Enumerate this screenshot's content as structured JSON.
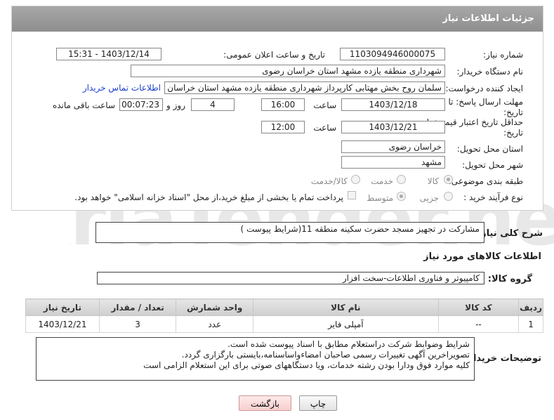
{
  "header": {
    "title": "جزئیات اطلاعات نیاز"
  },
  "fields": {
    "need_number_label": "شماره نیاز:",
    "need_number": "1103094946000075",
    "announce_label": "تاریخ و ساعت اعلان عمومی:",
    "announce_value": "1403/12/14 - 15:31",
    "buyer_label": "نام دستگاه خریدار:",
    "buyer_value": "شهرداری منطقه یازده مشهد استان خراسان رضوی",
    "requester_label": "ایجاد کننده درخواست:",
    "requester_value": "سلمان روح بخش مهتابی کارپرداز شهرداری منطقه یازده مشهد استان خراسان رضوی",
    "contact_link": "اطلاعات تماس خریدار",
    "reply_deadline_label": "مهلت ارسال پاسخ: تا",
    "reply_deadline_label2": "تاریخ:",
    "reply_date": "1403/12/18",
    "time_label": "ساعت",
    "reply_time": "16:00",
    "days_value": "4",
    "days_label": "روز و",
    "remaining_time": "00:07:23",
    "remaining_label": "ساعت باقی مانده",
    "price_deadline_label": "حداقل تاریخ اعتبار قیمت: تا",
    "price_deadline_label2": "تاریخ:",
    "price_date": "1403/12/21",
    "price_time": "12:00",
    "province_label": "استان محل تحویل:",
    "province_value": "خراسان رضوی",
    "city_label": "شهر محل تحویل:",
    "city_value": "مشهد",
    "category_label": "طبقه بندی موضوعی:",
    "category_options": [
      "کالا",
      "خدمت",
      "کالا/خدمت"
    ],
    "process_label": "نوع فرآیند خرید :",
    "process_options": [
      "جزیی",
      "متوسط"
    ],
    "payment_note": "پرداخت تمام یا بخشی از مبلغ خرید،از محل \"اسناد خزانه اسلامی\" خواهد بود."
  },
  "description": {
    "label": "شرح کلی نیاز:",
    "value": "مشارکت در تجهیز مسجد حضرت سکینه منطقه 11(شرایط پیوست )"
  },
  "goods_info": {
    "title": "اطلاعات کالاهای مورد نیاز",
    "group_label": "گروه کالا:",
    "group_value": "کامپیوتر و فناوری اطلاعات-سخت افزار"
  },
  "table": {
    "headers": [
      "ردیف",
      "کد کالا",
      "نام کالا",
      "واحد شمارش",
      "تعداد / مقدار",
      "تاریخ نیاز"
    ],
    "rows": [
      [
        "1",
        "--",
        "آمپلی فایر",
        "عدد",
        "3",
        "1403/12/21"
      ]
    ]
  },
  "buyer_notes": {
    "label": "توضیحات خریدار:",
    "lines": [
      "شرایط وضوابط شرکت دراستعلام مطابق با اسناد پیوست شده است.",
      "تصویراخرین آگهی تغییرات رسمی صاحبان امضاءواساسنامه،بایستی بارگزاری گردد.",
      "کلیه موارد فوق ودارا بودن رشته خدمات،  ویا دستگاههای صوتی برای این استعلام الزامی است"
    ]
  },
  "buttons": {
    "print": "چاپ",
    "back": "بازگشت"
  },
  "watermark": "AriaTender.neT"
}
